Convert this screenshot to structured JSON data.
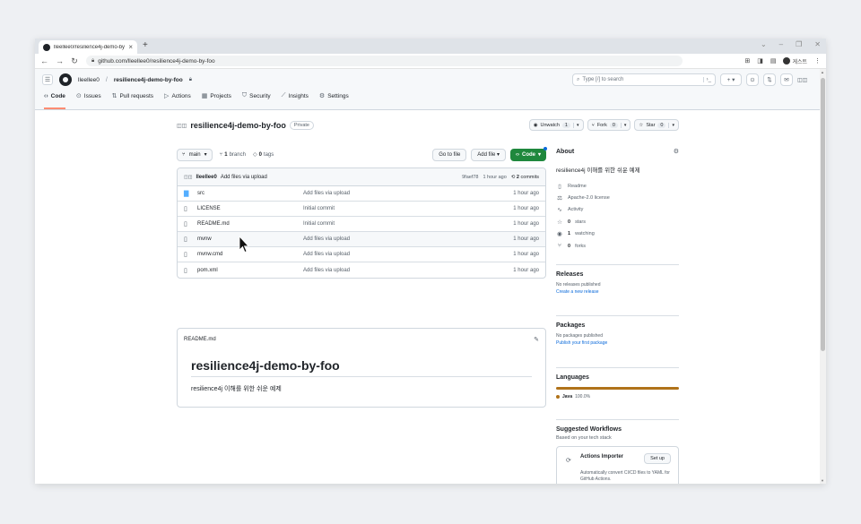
{
  "browser": {
    "tab_title": "lleellee0/resilience4j-demo-by-f",
    "url": "github.com/lleellee0/resilience4j-demo-by-foo",
    "profile_label": "게스트"
  },
  "header": {
    "owner": "lleellee0",
    "separator": "/",
    "repo": "resilience4j-demo-by-foo",
    "search_placeholder": "Type [/] to search",
    "plus_label": "+ ▾"
  },
  "repo_nav": [
    {
      "icon": "‹›",
      "label": "Code"
    },
    {
      "icon": "⊙",
      "label": "Issues"
    },
    {
      "icon": "⇅",
      "label": "Pull requests"
    },
    {
      "icon": "▷",
      "label": "Actions"
    },
    {
      "icon": "▦",
      "label": "Projects"
    },
    {
      "icon": "⛉",
      "label": "Security"
    },
    {
      "icon": "⟋",
      "label": "Insights"
    },
    {
      "icon": "⚙",
      "label": "Settings"
    }
  ],
  "repo": {
    "name": "resilience4j-demo-by-foo",
    "visibility": "Private",
    "unwatch_label": "Unwatch",
    "unwatch_count": "1",
    "fork_label": "Fork",
    "fork_count": "0",
    "star_label": "Star",
    "star_count": "0"
  },
  "branch_bar": {
    "branch": "main",
    "branches_count": "1",
    "branches_label": "branch",
    "tags_count": "0",
    "tags_label": "tags",
    "go_to_file": "Go to file",
    "add_file": "Add file",
    "code": "Code"
  },
  "latest_commit": {
    "user": "lleellee0",
    "message": "Add files via upload",
    "sha": "9faef78",
    "time": "1 hour ago",
    "commits_count": "2",
    "commits_label": "commits"
  },
  "files": [
    {
      "type": "dir",
      "name": "src",
      "message": "Add files via upload",
      "time": "1 hour ago"
    },
    {
      "type": "file",
      "name": "LICENSE",
      "message": "Initial commit",
      "time": "1 hour ago"
    },
    {
      "type": "file",
      "name": "README.md",
      "message": "Initial commit",
      "time": "1 hour ago"
    },
    {
      "type": "file",
      "name": "mvnw",
      "message": "Add files via upload",
      "time": "1 hour ago"
    },
    {
      "type": "file",
      "name": "mvnw.cmd",
      "message": "Add files via upload",
      "time": "1 hour ago"
    },
    {
      "type": "file",
      "name": "pom.xml",
      "message": "Add files via upload",
      "time": "1 hour ago"
    }
  ],
  "readme": {
    "filename": "README.md",
    "heading": "resilience4j-demo-by-foo",
    "body": "resilience4j 이해를 위한 쉬운 예제"
  },
  "about": {
    "title": "About",
    "description": "resilience4j 이해를 위한 쉬운 예제",
    "readme": "Readme",
    "license": "Apache-2.0 license",
    "activity": "Activity",
    "stars_count": "0",
    "stars_label": "stars",
    "watching_count": "1",
    "watching_label": "watching",
    "forks_count": "0",
    "forks_label": "forks"
  },
  "releases": {
    "title": "Releases",
    "empty": "No releases published",
    "link": "Create a new release"
  },
  "packages": {
    "title": "Packages",
    "empty": "No packages published",
    "link": "Publish your first package"
  },
  "languages": {
    "title": "Languages",
    "items": [
      {
        "name": "Java",
        "percent": "100.0%",
        "fraction": 1.0,
        "color": "#b07219"
      }
    ]
  },
  "workflows": {
    "title": "Suggested Workflows",
    "subtitle": "Based on your tech stack",
    "card_title": "Actions Importer",
    "card_button": "Set up",
    "card_desc": "Automatically convert CI/CD files to YAML for GitHub Actions."
  },
  "colors": {
    "accent_green": "#1f883d",
    "link_blue": "#0969da",
    "java": "#b07219",
    "tab_underline": "#fd8c73"
  }
}
